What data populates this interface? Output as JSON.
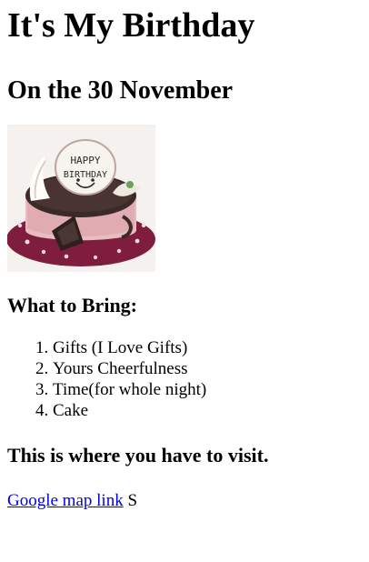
{
  "page": {
    "title": "It's My Birthday",
    "subtitle": "On the 30 November",
    "image": {
      "text": "HAPPY BIRTHDAY"
    },
    "bring_heading": "What to Bring:",
    "bring_items": [
      "Gifts (I Love Gifts)",
      "Yours Cheerfulness",
      "Time(for whole night)",
      "Cake"
    ],
    "visit_heading": "This is where you have to visit.",
    "map_link_text": "Google map link",
    "after_link_text": "S"
  },
  "colors": {
    "link": "#0000ee",
    "text": "#000000"
  }
}
